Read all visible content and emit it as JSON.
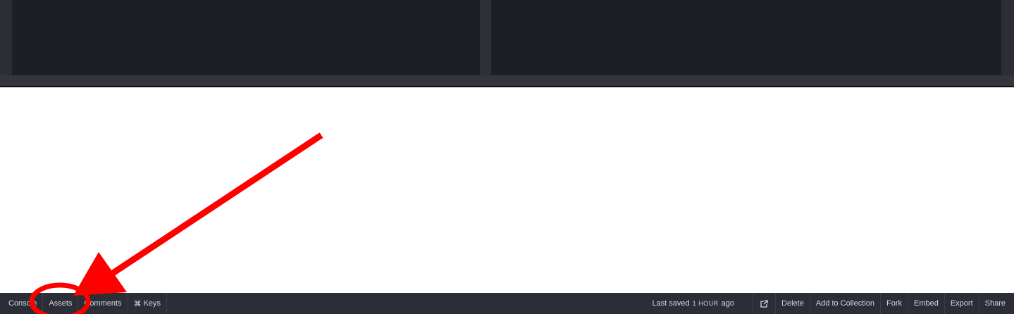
{
  "footer": {
    "left_buttons": [
      {
        "label": "Console"
      },
      {
        "label": "Assets"
      },
      {
        "label": "Comments"
      },
      {
        "label": "Keys",
        "icon": "command-icon",
        "glyph": "⌘"
      }
    ],
    "saved": {
      "prefix": "Last saved",
      "time": "1 hour",
      "suffix": "ago"
    },
    "right_buttons": [
      {
        "label": "Delete"
      },
      {
        "label": "Add to Collection"
      },
      {
        "label": "Fork"
      },
      {
        "label": "Embed"
      },
      {
        "label": "Export"
      },
      {
        "label": "Share"
      }
    ],
    "external_icon": "external-link-icon"
  },
  "colors": {
    "editor_bg": "#1e1f24",
    "chrome_bg": "#2b2d37",
    "footer_text": "#d8d9dd",
    "annotation": "#ff0000"
  }
}
